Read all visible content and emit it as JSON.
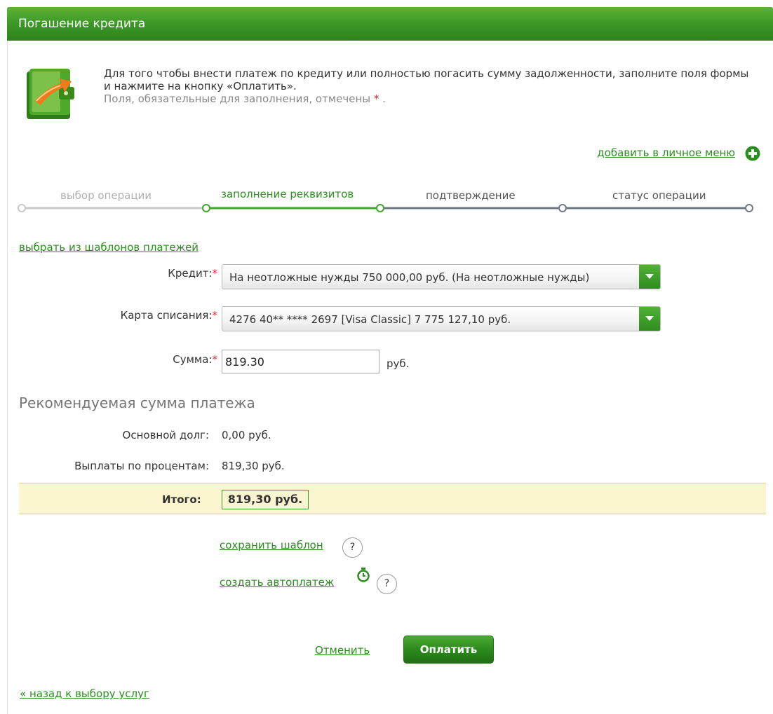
{
  "header": {
    "title": "Погашение кредита"
  },
  "intro": {
    "text": "Для того чтобы внести платеж по кредиту или полностью погасить сумму задолженности, заполните поля формы и нажмите на кнопку «Оплатить».",
    "hint": "Поля, обязательные для заполнения, отмечены",
    "required_mark": "*",
    "hint_end": " ."
  },
  "add_menu_label": "добавить в личное меню",
  "steps": [
    {
      "label": "выбор операции",
      "state": "done"
    },
    {
      "label": "заполнение реквизитов",
      "state": "current"
    },
    {
      "label": "подтверждение",
      "state": "pending"
    },
    {
      "label": "статус операции",
      "state": "pending"
    }
  ],
  "templates_link": "выбрать из шаблонов платежей",
  "form": {
    "credit_label": "Кредит:",
    "credit_value": "На неотложные нужды  750 000,00  руб.  (На неотложные нужды)",
    "card_label": "Карта списания:",
    "card_value": "4276 40** **** 2697  [Visa Classic] 7 775 127,10  руб.",
    "amount_label": "Сумма:",
    "amount_value": "819.30",
    "amount_unit": "руб.",
    "required_mark": "*"
  },
  "recommended": {
    "title": "Рекомендуемая сумма платежа",
    "principal_label": "Основной долг:",
    "principal_value": "0,00 руб.",
    "interest_label": "Выплаты по процентам:",
    "interest_value": "819,30 руб.",
    "total_label": "Итого:",
    "total_value": "819,30 руб."
  },
  "actions": {
    "save_template": "сохранить шаблон",
    "create_autopay": "создать автоплатеж",
    "help_glyph": "?",
    "cancel": "Отменить",
    "pay": "Оплатить",
    "back": "« назад к выбору услуг"
  },
  "colors": {
    "brand_green": "#2a8f1d",
    "required_red": "#e3262c",
    "step_done": "#c8c8c8",
    "step_current": "#3fa52c",
    "step_pending": "#6d7a86"
  }
}
